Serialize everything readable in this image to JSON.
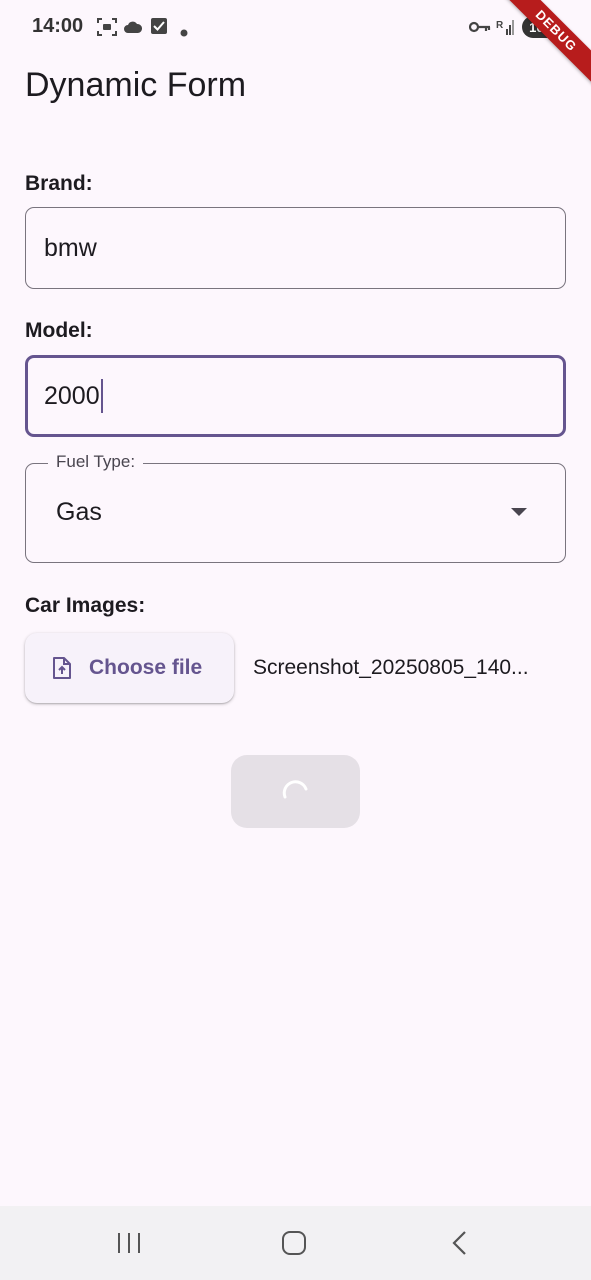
{
  "status_bar": {
    "time": "14:00",
    "battery": "100",
    "debug_banner": "DEBUG",
    "left_icons": [
      "screenshot-icon",
      "cloud-icon",
      "checkbox-icon",
      "dot-icon"
    ],
    "right_icons": [
      "vpn-key-icon",
      "signal-icon",
      "battery-icon"
    ]
  },
  "page": {
    "title": "Dynamic Form"
  },
  "form": {
    "brand": {
      "label": "Brand:",
      "value": "bmw"
    },
    "model": {
      "label": "Model:",
      "value": "2000"
    },
    "fuel_type": {
      "label": "Fuel Type:",
      "selected": "Gas"
    },
    "car_images": {
      "label": "Car Images:",
      "button_label": "Choose file",
      "file_name": "Screenshot_20250805_140..."
    },
    "submit": {
      "state": "loading"
    }
  },
  "nav_bar": {
    "buttons": [
      "recent-apps-icon",
      "home-icon",
      "back-icon"
    ]
  },
  "colors": {
    "primary": "#65558f",
    "background": "#fdf7fd",
    "outline": "#79747e",
    "debug_ribbon": "#b71c1c"
  }
}
